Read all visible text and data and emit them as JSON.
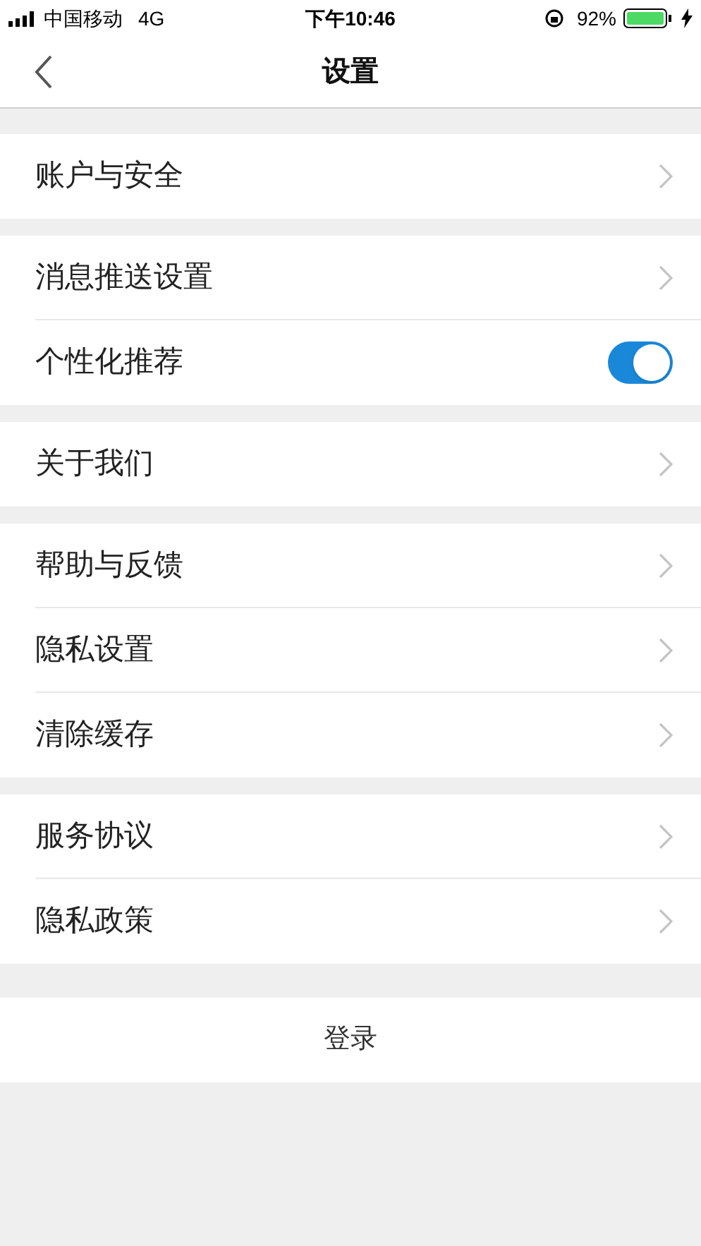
{
  "status_bar": {
    "carrier": "中国移动",
    "network": "4G",
    "time": "下午10:46",
    "battery": "92%"
  },
  "nav": {
    "title": "设置"
  },
  "groups": [
    {
      "items": [
        {
          "kind": "link",
          "label": "账户与安全"
        }
      ]
    },
    {
      "items": [
        {
          "kind": "link",
          "label": "消息推送设置"
        },
        {
          "kind": "toggle",
          "label": "个性化推荐",
          "on": true
        }
      ]
    },
    {
      "items": [
        {
          "kind": "link",
          "label": "关于我们"
        }
      ]
    },
    {
      "items": [
        {
          "kind": "link",
          "label": "帮助与反馈"
        },
        {
          "kind": "link",
          "label": "隐私设置"
        },
        {
          "kind": "link",
          "label": "清除缓存"
        }
      ]
    },
    {
      "items": [
        {
          "kind": "link",
          "label": "服务协议"
        },
        {
          "kind": "link",
          "label": "隐私政策"
        }
      ]
    }
  ],
  "login_button": "登录"
}
